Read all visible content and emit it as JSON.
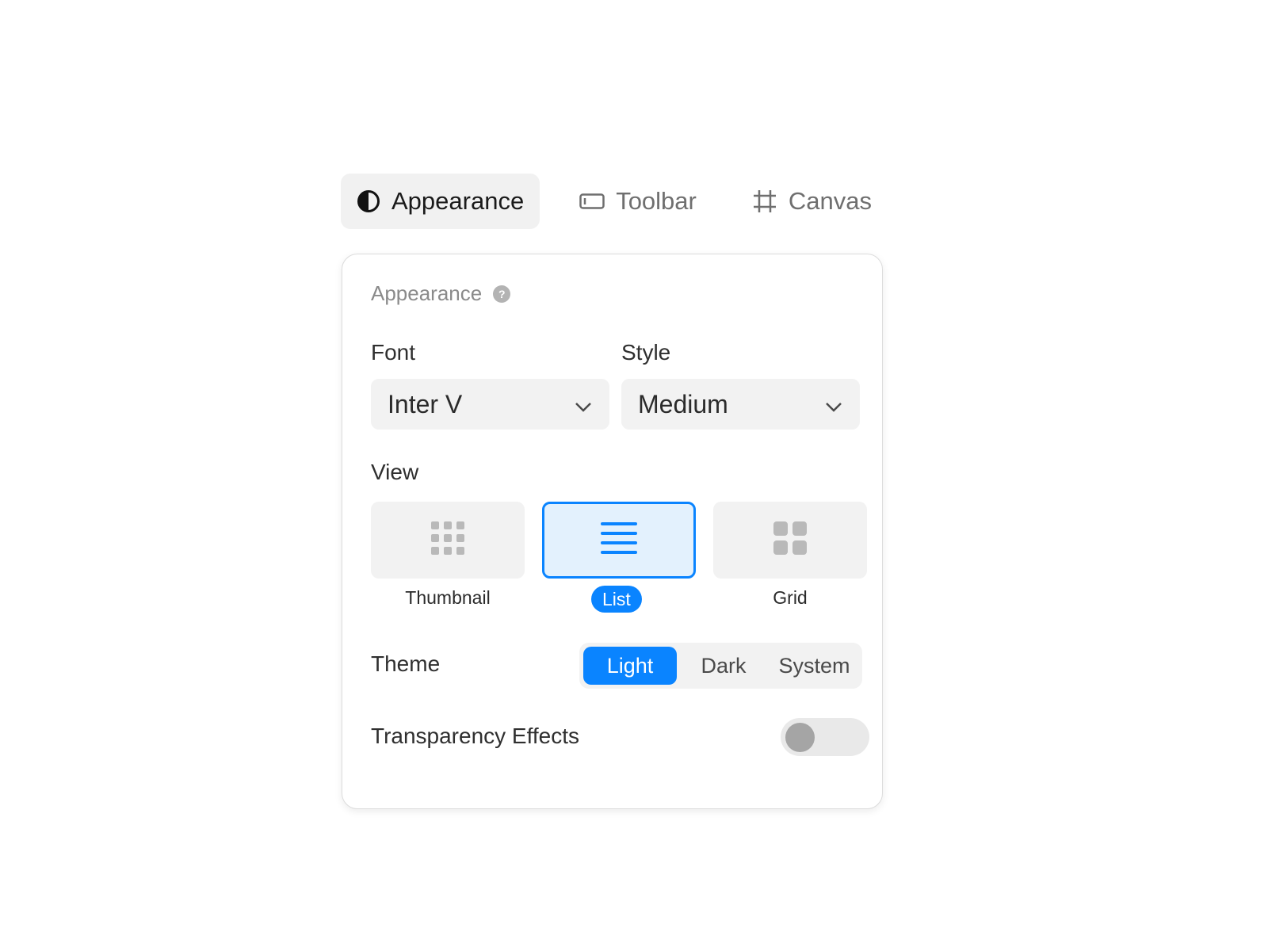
{
  "tabs": [
    {
      "label": "Appearance",
      "icon": "half-circle-icon",
      "active": true
    },
    {
      "label": "Toolbar",
      "icon": "toolbar-icon",
      "active": false
    },
    {
      "label": "Canvas",
      "icon": "frame-icon",
      "active": false
    }
  ],
  "panel": {
    "title": "Appearance",
    "help_glyph": "?",
    "font": {
      "label": "Font",
      "value": "Inter V"
    },
    "style": {
      "label": "Style",
      "value": "Medium"
    },
    "view": {
      "label": "View",
      "options": [
        {
          "label": "Thumbnail",
          "icon": "dots-grid-icon",
          "selected": false
        },
        {
          "label": "List",
          "icon": "list-icon",
          "selected": true
        },
        {
          "label": "Grid",
          "icon": "squares-grid-icon",
          "selected": false
        }
      ]
    },
    "theme": {
      "label": "Theme",
      "options": [
        "Light",
        "Dark",
        "System"
      ],
      "selected": "Light"
    },
    "transparency": {
      "label": "Transparency Effects",
      "enabled": false
    }
  },
  "colors": {
    "accent": "#0a84ff",
    "selected_card_bg": "#e3f1fd",
    "control_bg": "#f2f2f2"
  }
}
